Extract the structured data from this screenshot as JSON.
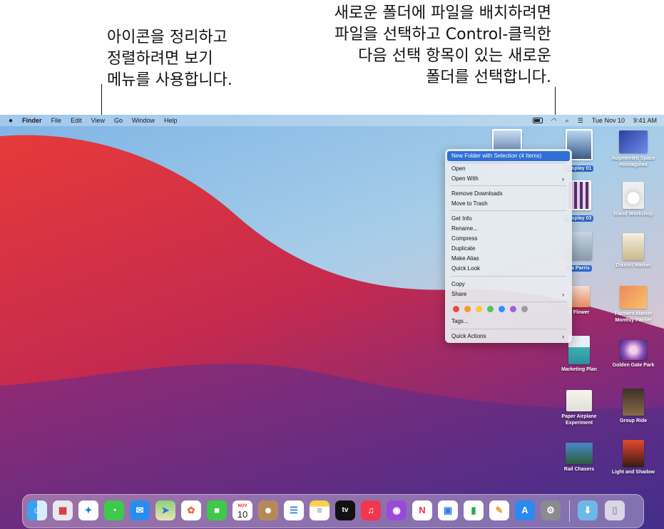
{
  "callouts": {
    "left": "아이콘을 정리하고\n정렬하려면 보기\n메뉴를 사용합니다.",
    "right": "새로운 폴더에 파일을 배치하려면\n파일을 선택하고 Control-클릭한\n다음 선택 항목이 있는 새로운\n폴더를 선택합니다."
  },
  "menubar": {
    "apple": "",
    "items": [
      "Finder",
      "File",
      "Edit",
      "View",
      "Go",
      "Window",
      "Help"
    ],
    "date": "Tue Nov 10",
    "time": "9:41 AM"
  },
  "context_menu": {
    "groups": [
      [
        {
          "label": "New Folder with Selection (4 Items)",
          "selected": true
        }
      ],
      [
        {
          "label": "Open"
        },
        {
          "label": "Open With",
          "submenu": true
        }
      ],
      [
        {
          "label": "Remove Downloads"
        },
        {
          "label": "Move to Trash"
        }
      ],
      [
        {
          "label": "Get Info"
        },
        {
          "label": "Rename..."
        },
        {
          "label": "Compress"
        },
        {
          "label": "Duplicate"
        },
        {
          "label": "Make Alias"
        },
        {
          "label": "Quick Look"
        }
      ],
      [
        {
          "label": "Copy"
        },
        {
          "label": "Share",
          "submenu": true
        }
      ],
      [
        {
          "label": "Tags..."
        }
      ],
      [
        {
          "label": "Quick Actions",
          "submenu": true
        }
      ]
    ],
    "tag_colors": [
      "#ec4b40",
      "#f59a2c",
      "#f6cc2e",
      "#4fc45a",
      "#2f8ff6",
      "#a060d8",
      "#9c9ca0"
    ]
  },
  "desktop_icons": [
    {
      "label": "Display 01",
      "selected": true
    },
    {
      "label": "Augmented Space Reimagined"
    },
    {
      "label": "Display 03",
      "selected": true
    },
    {
      "label": "Bland Workshop"
    },
    {
      "label": "sa Parris",
      "selected": true
    },
    {
      "label": "District Market"
    },
    {
      "label": "o Flower"
    },
    {
      "label": "Farmers Market Monthly Packet"
    },
    {
      "label": "Marketing Plan"
    },
    {
      "label": "Golden Gate Park"
    },
    {
      "label": "Paper Airplane Experiment"
    },
    {
      "label": "Group Ride"
    },
    {
      "label": "Rail Chasers"
    },
    {
      "label": "Light and Shadow"
    }
  ],
  "dock": {
    "calendar_month": "NOV",
    "calendar_day": "10",
    "tv_label": "tv",
    "apps": [
      "Finder",
      "Launchpad",
      "Safari",
      "Messages",
      "Mail",
      "Maps",
      "Photos",
      "FaceTime",
      "Calendar",
      "Contacts",
      "Reminders",
      "Notes",
      "TV",
      "Music",
      "Podcasts",
      "News",
      "Keynote",
      "Numbers",
      "Pages",
      "App Store",
      "System Preferences",
      "Downloads",
      "Trash"
    ]
  }
}
